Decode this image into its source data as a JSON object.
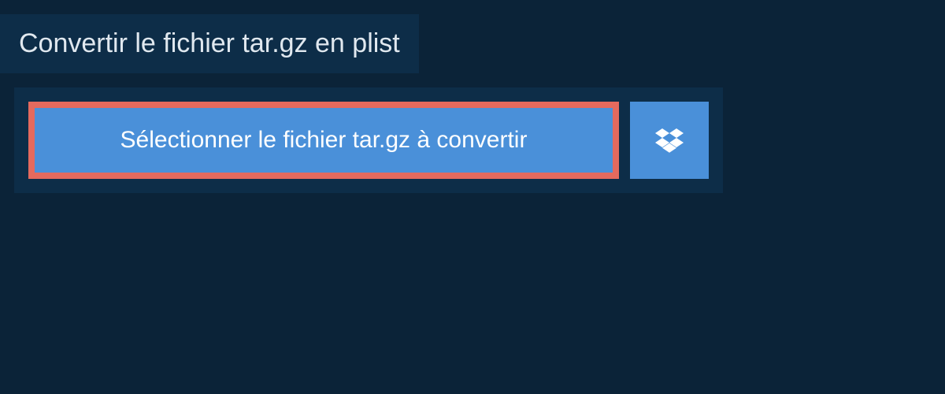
{
  "header": {
    "title": "Convertir le fichier tar.gz en plist"
  },
  "actions": {
    "select_file_label": "Sélectionner le fichier tar.gz à convertir"
  }
}
